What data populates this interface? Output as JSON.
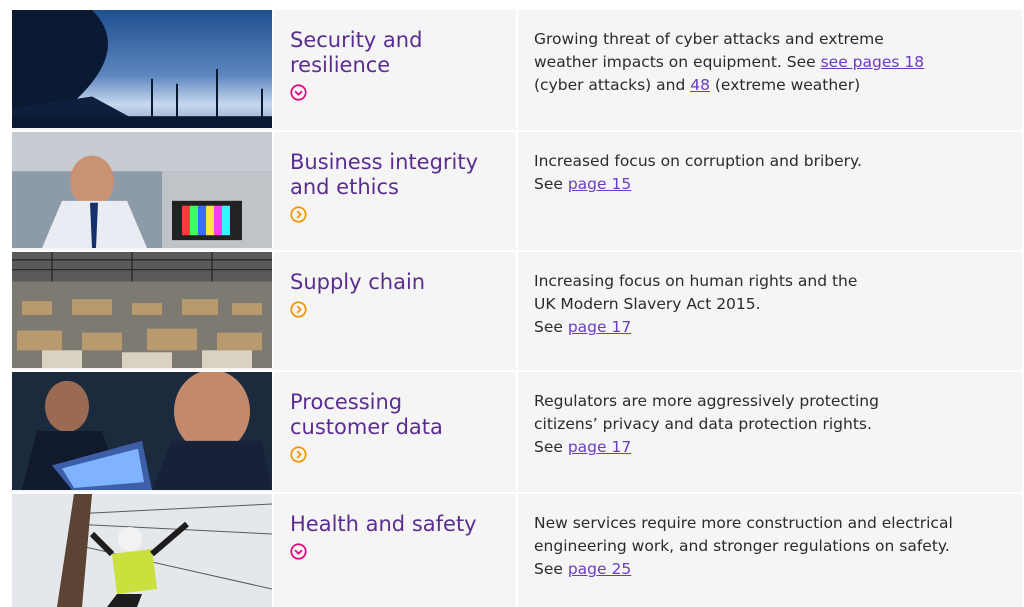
{
  "rows": [
    {
      "title": "Security and resilience",
      "icon": "chevron-down-circle-icon",
      "icon_color": "#e6007e",
      "desc_line1": "Growing threat of cyber attacks and extreme",
      "desc_line2a": "weather impacts on equipment. See ",
      "link1": "see pages 18",
      "desc_line3a": "(cyber attacks) and ",
      "link2": "48",
      "desc_line3b": " (extreme weather)"
    },
    {
      "title": "Business integrity and ethics",
      "icon": "chevron-right-circle-icon",
      "icon_color": "#f29400",
      "desc_line1": "Increased focus on corruption and bribery.",
      "desc_see": "See ",
      "link1": "page 15"
    },
    {
      "title": "Supply chain",
      "icon": "chevron-right-circle-icon",
      "icon_color": "#f29400",
      "desc_line1": "Increasing focus on human rights and the",
      "desc_line2": "UK Modern Slavery Act 2015.",
      "desc_see": "See ",
      "link1": "page 17"
    },
    {
      "title": "Processing customer data",
      "icon": "chevron-right-circle-icon",
      "icon_color": "#f29400",
      "desc_line1": "Regulators are more aggressively protecting",
      "desc_line2": "citizens’ privacy and data protection rights.",
      "desc_see": "See ",
      "link1": "page 17"
    },
    {
      "title": "Health and safety",
      "icon": "chevron-down-circle-icon",
      "icon_color": "#e6007e",
      "desc_line1": "New services require more construction and electrical",
      "desc_line2": "engineering work, and stronger regulations on safety.",
      "desc_see": "See ",
      "link1": "page 25"
    }
  ],
  "colors": {
    "title": "#5b2d91",
    "link": "#6b3cc3",
    "cell_bg": "#f5f5f5"
  }
}
